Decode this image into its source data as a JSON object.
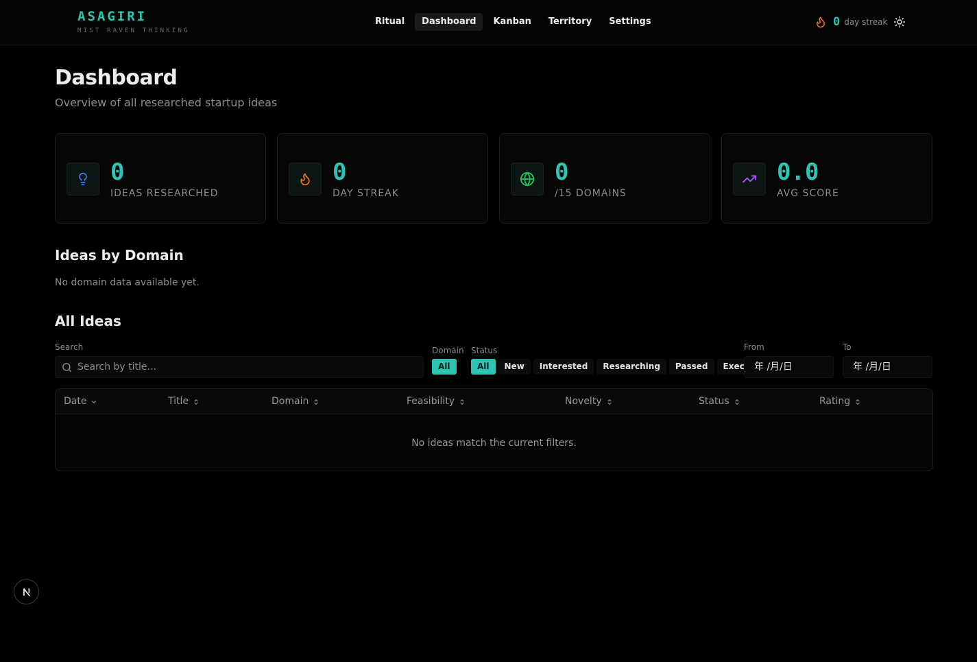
{
  "brand": {
    "name": "ASAGIRI",
    "tagline": "MIST RAVEN THINKING"
  },
  "nav": {
    "items": [
      "Ritual",
      "Dashboard",
      "Kanban",
      "Territory",
      "Settings"
    ],
    "active": "Dashboard"
  },
  "streak": {
    "count": "0",
    "label": "day streak",
    "icon": "flame-icon"
  },
  "theme_toggle": {
    "icon": "sun-icon"
  },
  "page": {
    "title": "Dashboard",
    "subtitle": "Overview of all researched startup ideas"
  },
  "stats": [
    {
      "value": "0",
      "label": "IDEAS RESEARCHED",
      "icon": "lightbulb-icon",
      "color": "#3b82f6"
    },
    {
      "value": "0",
      "label": "DAY STREAK",
      "icon": "flame-icon",
      "color": "#f97316"
    },
    {
      "value": "0",
      "label": "/15 DOMAINS",
      "icon": "globe-icon",
      "color": "#22c55e"
    },
    {
      "value": "0.0",
      "label": "AVG SCORE",
      "icon": "trending-up-icon",
      "color": "#a855f7"
    }
  ],
  "domains_section": {
    "title": "Ideas by Domain",
    "empty": "No domain data available yet."
  },
  "ideas_section": {
    "title": "All Ideas"
  },
  "filters": {
    "search_label": "Search",
    "search_placeholder": "Search by title...",
    "domain_label": "Domain",
    "domain_options": [
      "All"
    ],
    "status_label": "Status",
    "status_options": [
      "All",
      "New",
      "Interested",
      "Researching",
      "Passed",
      "Executing"
    ],
    "from_label": "From",
    "to_label": "To",
    "from_value": "年 /月/日",
    "to_value": "年 /月/日"
  },
  "table": {
    "columns": [
      "Date",
      "Title",
      "Domain",
      "Feasibility",
      "Novelty",
      "Status",
      "Rating"
    ],
    "empty": "No ideas match the current filters."
  },
  "dev_badge": {
    "label": "N"
  },
  "colors": {
    "accent": "#2ec4b2",
    "background": "#000000"
  }
}
